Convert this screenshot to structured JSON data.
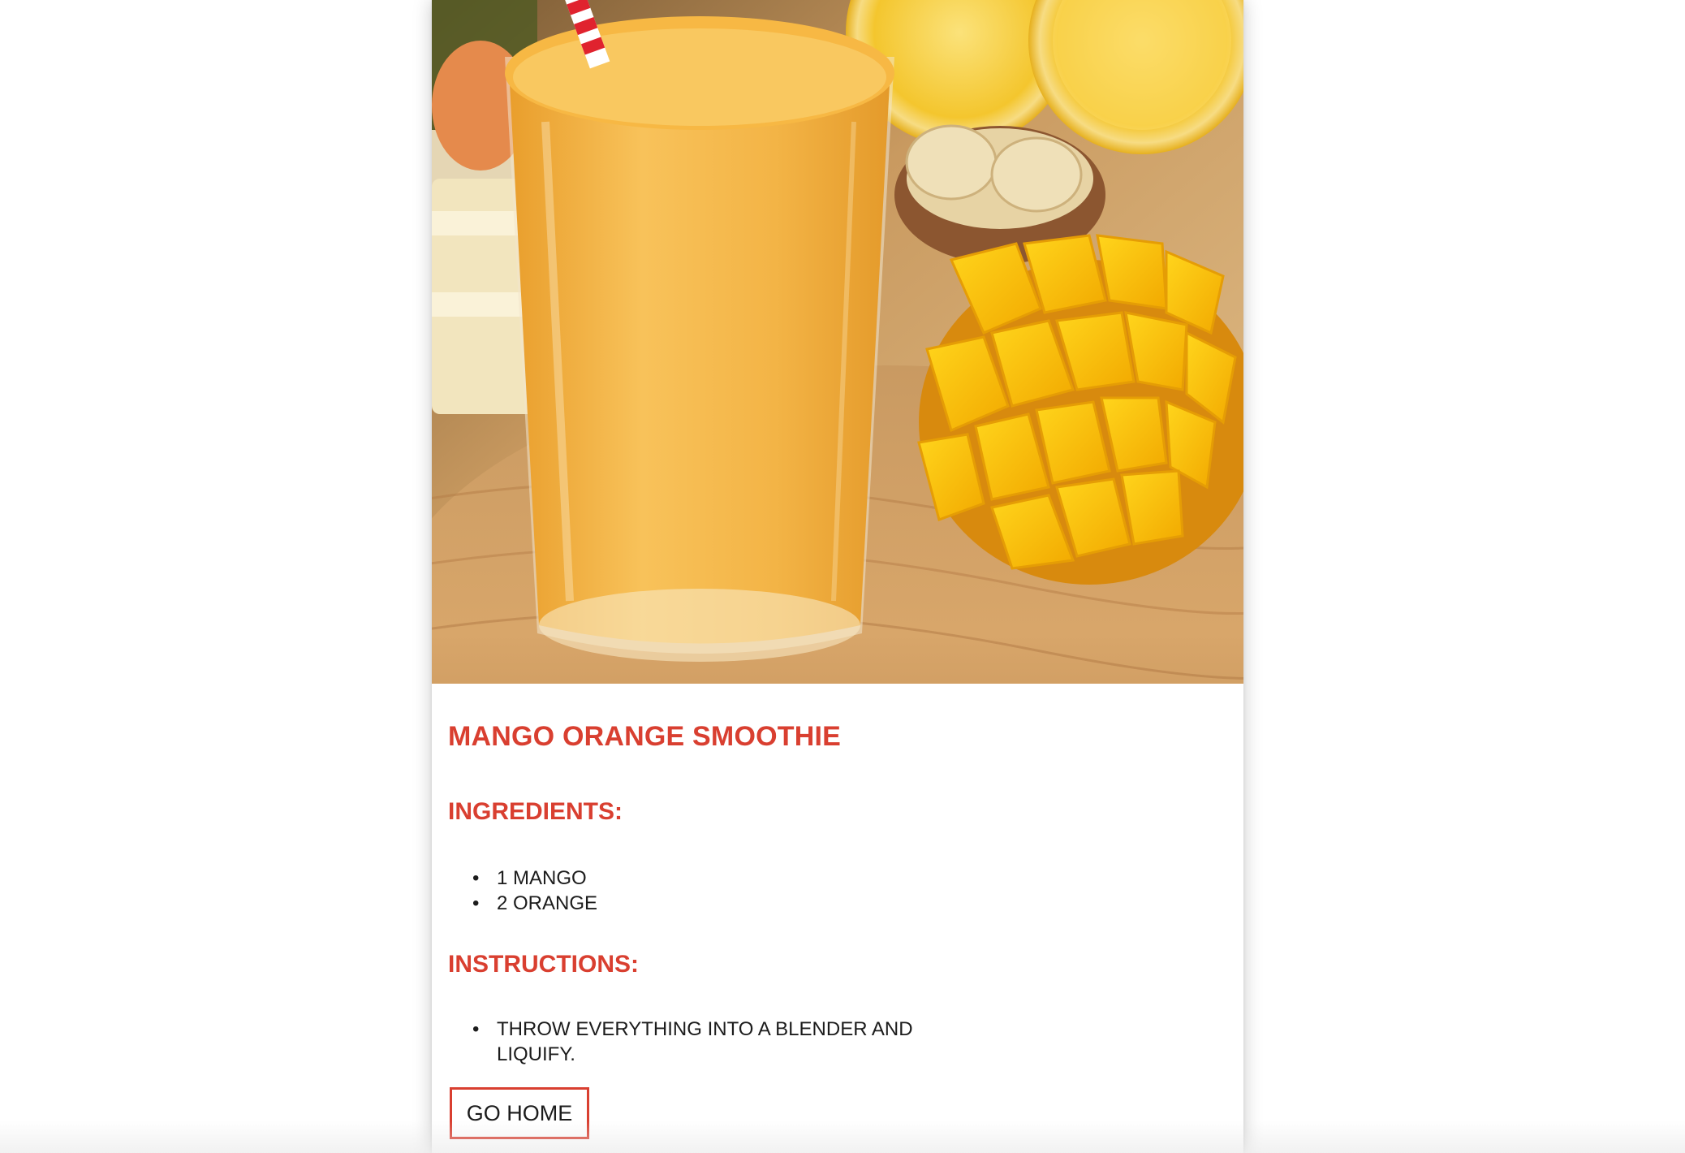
{
  "colors": {
    "accent": "#d93f30",
    "text": "#1c1c1c",
    "background": "#ffffff"
  },
  "recipe": {
    "title": "MANGO ORANGE SMOOTHIE",
    "ingredients_heading": "INGREDIENTS:",
    "ingredients": [
      "1 MANGO",
      "2 ORANGE"
    ],
    "instructions_heading": "INSTRUCTIONS:",
    "instructions": [
      "THROW EVERYTHING INTO A BLENDER AND LIQUIFY."
    ]
  },
  "actions": {
    "go_home_label": "GO HOME"
  }
}
